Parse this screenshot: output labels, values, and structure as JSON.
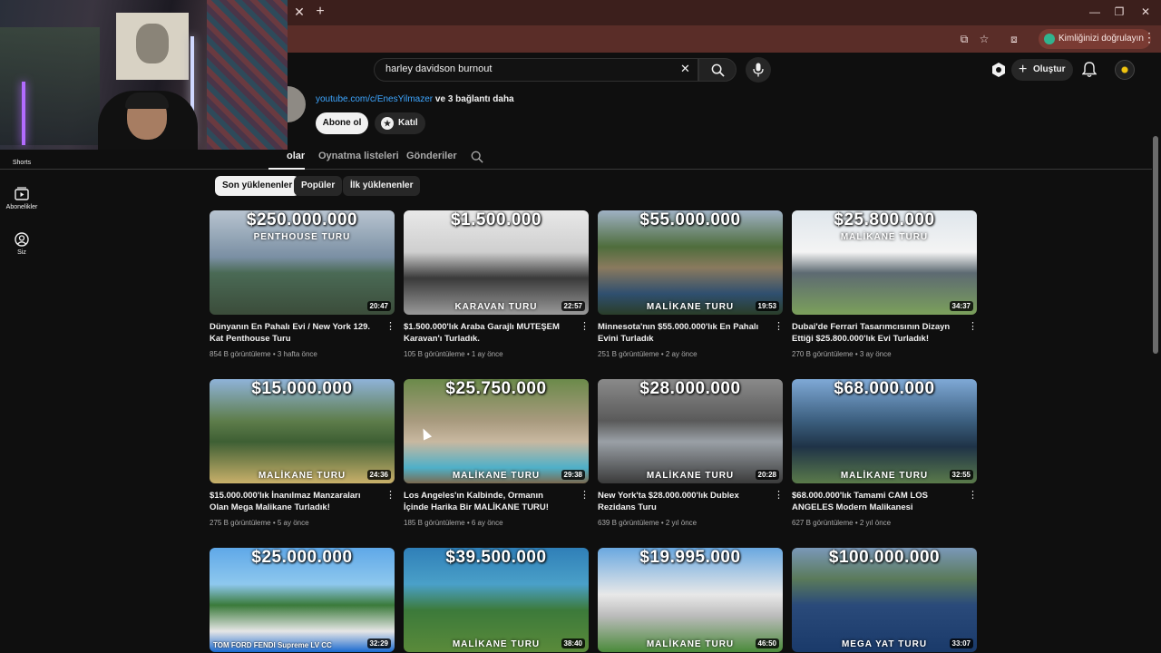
{
  "browser": {
    "profile_chip": "Kimliğinizi doğrulayın"
  },
  "masthead": {
    "search_value": "harley davidson burnout",
    "create_label": "Oluştur"
  },
  "sidebar": {
    "items": [
      {
        "label": "Shorts",
        "icon": "shorts-icon"
      },
      {
        "label": "Abonelikler",
        "icon": "subscriptions-icon"
      },
      {
        "label": "Siz",
        "icon": "you-icon"
      }
    ]
  },
  "channel": {
    "link_url": "youtube.com/c/EnesYilmazer",
    "link_more": "ve 3 bağlantı daha",
    "subscribe_label": "Abone ol",
    "join_label": "Katıl"
  },
  "tabs": [
    {
      "label": "olar",
      "active": true
    },
    {
      "label": "Oynatma listeleri",
      "active": false
    },
    {
      "label": "Gönderiler",
      "active": false
    }
  ],
  "chips": [
    {
      "label": "Son yüklenenler",
      "active": true
    },
    {
      "label": "Popüler",
      "active": false
    },
    {
      "label": "İlk yüklenenler",
      "active": false
    }
  ],
  "videos": [
    {
      "price": "$250.000.000",
      "subtitle": "PENTHOUSE TURU",
      "duration": "20:47",
      "title": "Dünyanın En Pahalı Evi / New York 129. Kat Penthouse Turu",
      "meta": "854 B görüntüleme • 3 hafta önce",
      "bg": "linear-gradient(180deg,#b8c4d0 0%,#7a8fa3 45%,#4a6a55 60%,#3b4c3a 100%)"
    },
    {
      "price": "$1.500.000",
      "subtitle": "KARAVAN TURU",
      "duration": "22:57",
      "title": "$1.500.000'lık Araba Garajlı MUTEŞEM Karavan'ı Turladık.",
      "meta": "105 B görüntüleme • 1 ay önce",
      "bg": "linear-gradient(180deg,#e8e8e8 0%,#cfcfcf 40%,#3a3a3a 65%,#9a9a9a 100%)"
    },
    {
      "price": "$55.000.000",
      "subtitle": "MALİKANE TURU",
      "duration": "19:53",
      "title": "Minnesota'nın $55.000.000'lık En Pahalı Evini Turladık",
      "meta": "251 B görüntüleme • 2 ay önce",
      "bg": "linear-gradient(180deg,#9fb1c4 0%,#4f6d3c 35%,#8a7a5e 55%,#2f4f6f 80%,#2a3d28 100%)"
    },
    {
      "price": "$25.800.000",
      "subtitle": "MALİKANE TURU",
      "duration": "34:37",
      "title": "Dubai'de Ferrari Tasarımcısının Dizayn Ettiği $25.800.000'lık Evi Turladık!",
      "meta": "270 B görüntüleme • 3 ay önce",
      "bg": "linear-gradient(180deg,#dfe6ec 0%,#f4f4f4 40%,#5d6a72 60%,#7ba05b 100%)"
    },
    {
      "price": "$15.000.000",
      "subtitle": "MALİKANE TURU",
      "duration": "24:36",
      "title": "$15.000.000'lık İnanılmaz Manzaraları Olan Mega Malikane Turladık!",
      "meta": "275 B görüntüleme • 5 ay önce",
      "bg": "linear-gradient(180deg,#8fb3d9 0%,#5e7d4b 40%,#3e5f34 60%,#c9b06a 100%)"
    },
    {
      "price": "$25.750.000",
      "subtitle": "MALİKANE TURU",
      "duration": "29:38",
      "title": "Los Angeles'ın Kalbinde, Ormanın İçinde Harika Bir MALİKANE TURU!",
      "meta": "185 B görüntüleme • 6 ay önce",
      "bg": "linear-gradient(180deg,#6b8a4a 0%,#a89a7e 40%,#c8b8a0 60%,#4fb0c8 85%,#7a6a50 100%)"
    },
    {
      "price": "$28.000.000",
      "subtitle": "MALİKANE TURU",
      "duration": "20:28",
      "title": "New York'ta $28.000.000'lık Dublex Rezidans Turu",
      "meta": "639 B görüntüleme • 2 yıl önce",
      "bg": "linear-gradient(180deg,#8a8a8a 0%,#5a5a5a 40%,#9aa0a6 60%,#3a3a3a 100%)"
    },
    {
      "price": "$68.000.000",
      "subtitle": "MALİKANE TURU",
      "duration": "32:55",
      "title": "$68.000.000'lık Tamami CAM LOS ANGELES Modern Malikanesi",
      "meta": "627 B görüntüleme • 2 yıl önce",
      "bg": "linear-gradient(180deg,#7fa9d6 0%,#3c5f7f 40%,#1f3347 65%,#5a7a4a 100%)"
    },
    {
      "price": "$25.000.000",
      "subtitle": "",
      "brands": "TOM FORD  FENDI  Supreme  LV  CC",
      "duration": "32:29",
      "title": "",
      "meta": "",
      "bg": "linear-gradient(180deg,#5fa8e8 0%,#8ec8ee 35%,#3a7a3a 55%,#e6e6e6 80%,#1a6ad0 100%)"
    },
    {
      "price": "$39.500.000",
      "subtitle": "MALİKANE TURU",
      "duration": "38:40",
      "title": "",
      "meta": "",
      "bg": "linear-gradient(180deg,#2f7fb8 0%,#4aa0c8 35%,#3c7a3a 60%,#5a8a3a 100%)"
    },
    {
      "price": "$19.995.000",
      "subtitle": "MALİKANE TURU",
      "duration": "46:50",
      "title": "",
      "meta": "",
      "bg": "linear-gradient(180deg,#6aa8e0 0%,#e8e8e8 45%,#bcbcbc 65%,#4a8a3a 100%)"
    },
    {
      "price": "$100.000.000",
      "subtitle": "MEGA YAT TURU",
      "duration": "33:07",
      "title": "",
      "meta": "",
      "bg": "linear-gradient(180deg,#7a98b8 0%,#5a7a5a 30%,#2a4a7a 55%,#1a3a6a 100%)"
    }
  ]
}
